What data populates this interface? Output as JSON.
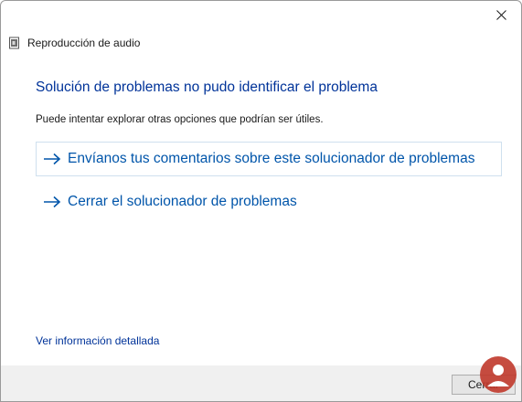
{
  "window": {
    "app_title": "Reproducción de audio"
  },
  "icons": {
    "close": "close-icon",
    "app": "audio-file-icon",
    "arrow": "arrow-right-icon",
    "watermark": "solvetic-logo"
  },
  "main": {
    "title": "Solución de problemas no pudo identificar el problema",
    "subtitle": "Puede intentar explorar otras opciones que podrían ser útiles.",
    "links": [
      {
        "label": "Envíanos tus comentarios sobre este solucionador de problemas"
      },
      {
        "label": "Cerrar el solucionador de problemas"
      }
    ],
    "details_link": "Ver información detallada"
  },
  "footer": {
    "cancel_label": "Cerrar"
  },
  "colors": {
    "title": "#003399",
    "link": "#0055aa",
    "bar": "#f0f0f0",
    "focus_border": "#cfe0ee"
  }
}
